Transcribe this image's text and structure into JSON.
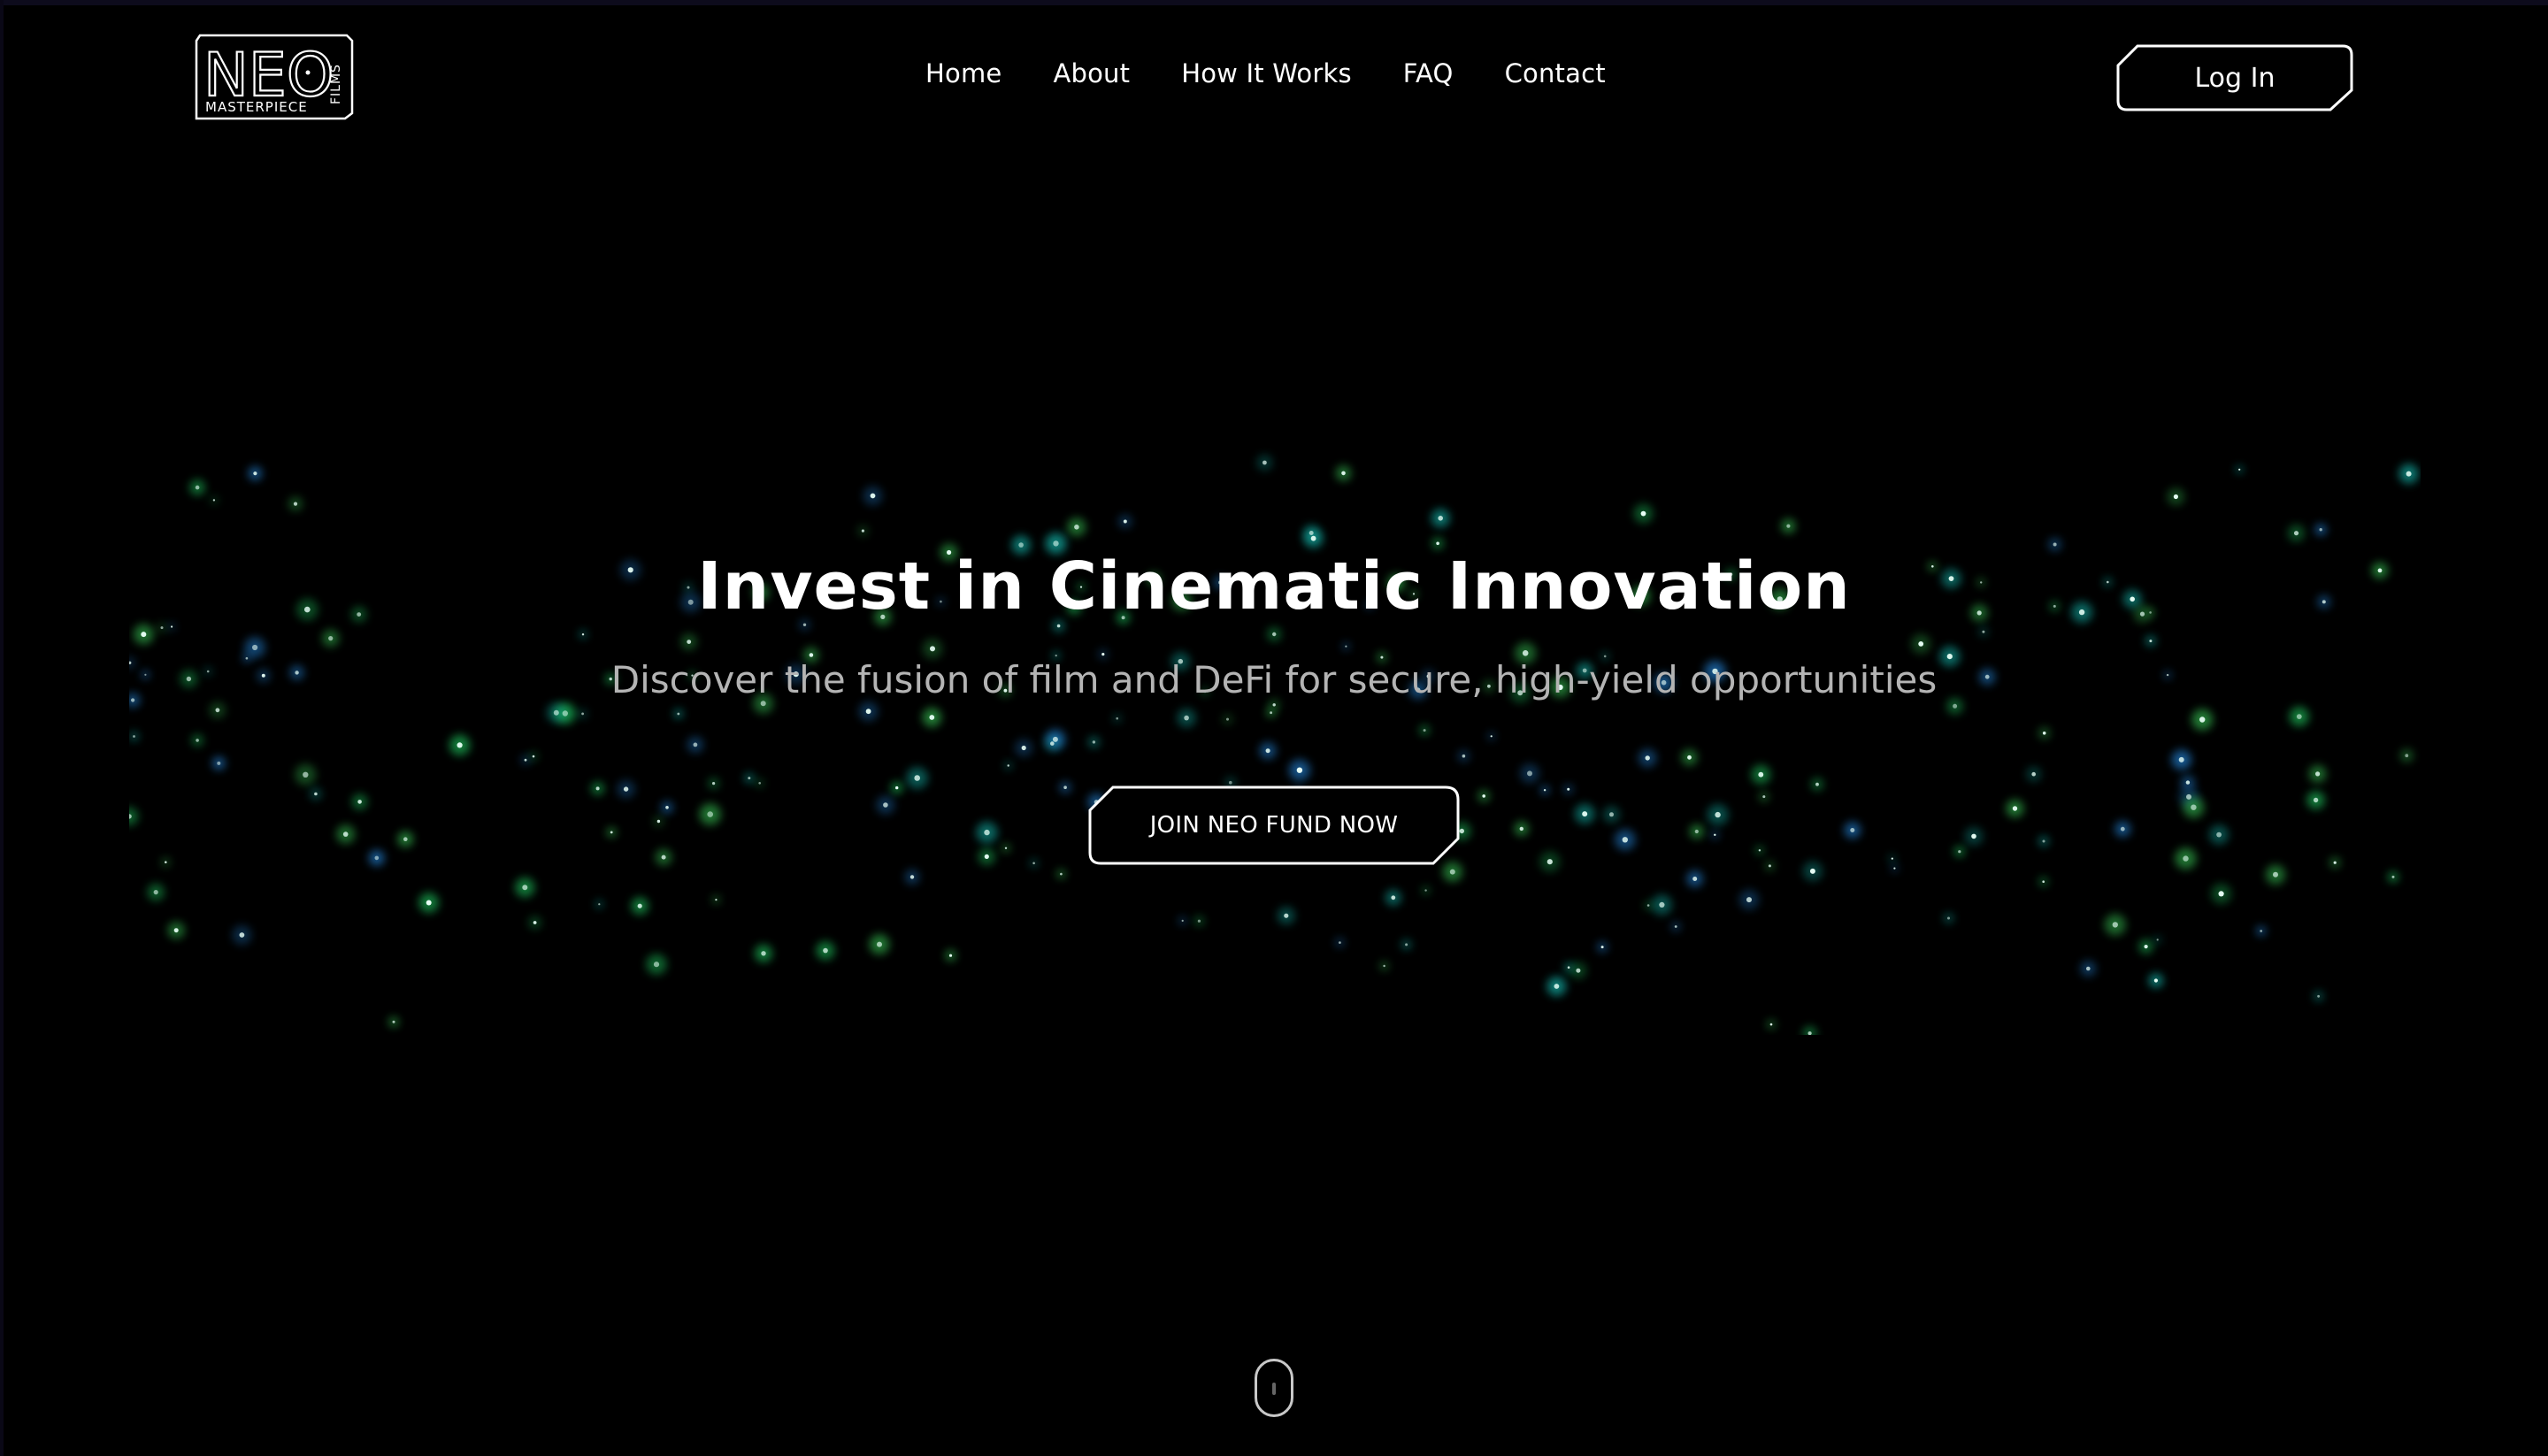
{
  "brand": {
    "logo_main": "NEO",
    "logo_sub": "MASTERPIECE",
    "logo_side": "FILMS"
  },
  "nav": {
    "items": [
      {
        "label": "Home"
      },
      {
        "label": "About"
      },
      {
        "label": "How It Works"
      },
      {
        "label": "FAQ"
      },
      {
        "label": "Contact"
      }
    ]
  },
  "header": {
    "login_label": "Log In"
  },
  "hero": {
    "title": "Invest in Cinematic Innovation",
    "subtitle": "Discover the fusion of film and DeFi for secure, high-yield opportunities",
    "cta_label": "JOIN NEO FUND NOW"
  },
  "theme": {
    "background": "#000000",
    "text": "#ffffff",
    "subtitle_color": "#b4b4b4",
    "particle_colors": [
      "#22e06a",
      "#18d4c8",
      "#2a9cff",
      "#3ad15a"
    ]
  },
  "icons": {
    "scroll_indicator": "mouse-scroll-icon"
  }
}
